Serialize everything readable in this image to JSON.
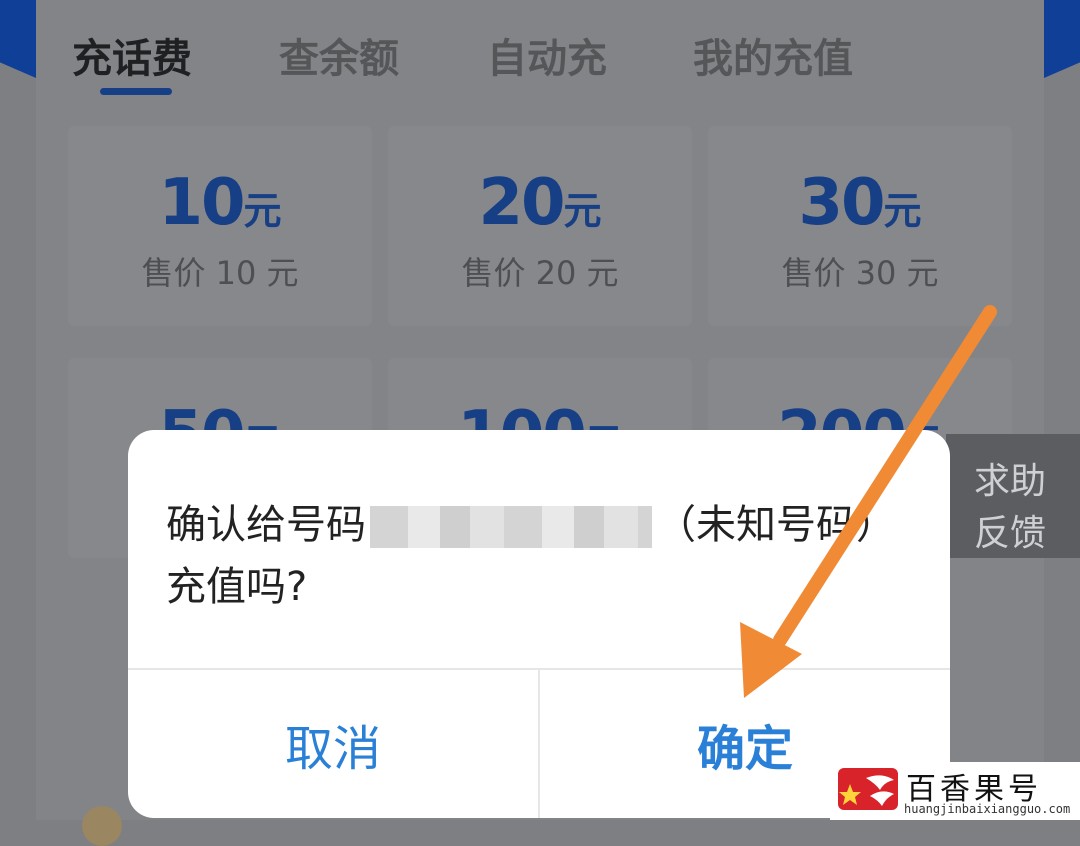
{
  "tabs": [
    {
      "label": "充话费",
      "active": true
    },
    {
      "label": "查余额",
      "active": false
    },
    {
      "label": "自动充",
      "active": false
    },
    {
      "label": "我的充值",
      "active": false
    }
  ],
  "options": [
    {
      "amount": "10",
      "unit": "元",
      "price": "售价 10 元"
    },
    {
      "amount": "20",
      "unit": "元",
      "price": "售价 20 元"
    },
    {
      "amount": "30",
      "unit": "元",
      "price": "售价 30 元"
    },
    {
      "amount": "50",
      "unit": "元"
    },
    {
      "amount": "100",
      "unit": "元"
    },
    {
      "amount": "200",
      "unit": "元"
    }
  ],
  "help": {
    "line1": "求助",
    "line2": "反馈"
  },
  "dialog": {
    "message_prefix": "确认给号码",
    "message_suffix": "（未知号码）充值吗?",
    "cancel_label": "取消",
    "confirm_label": "确定"
  },
  "watermark": {
    "title": "百香果号",
    "url": "huangjinbaixiangguo.com"
  },
  "colors": {
    "accent": "#2a80d6",
    "arrow": "#f08a35",
    "brand_blue": "#163f85"
  }
}
